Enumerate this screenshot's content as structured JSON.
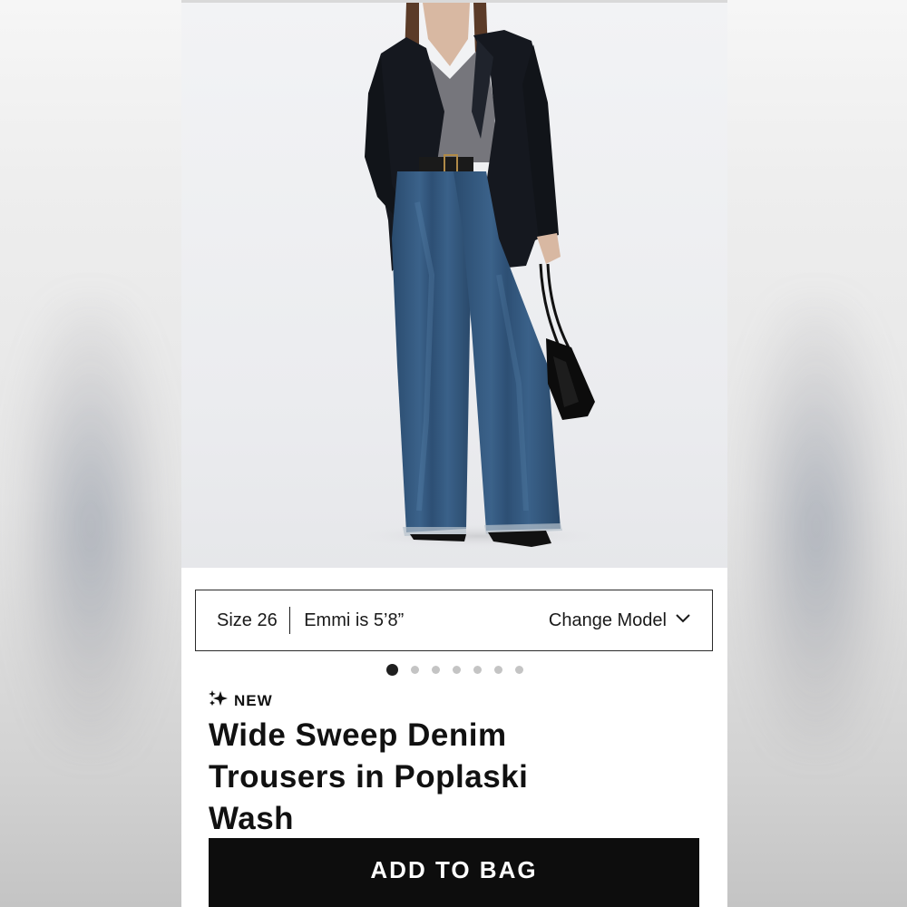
{
  "model_bar": {
    "size": "Size 26",
    "model_info": "Emmi is 5’8”",
    "change_model": "Change Model"
  },
  "carousel": {
    "total": 7,
    "active": 0
  },
  "product": {
    "badge": "NEW",
    "title": "Wide Sweep Denim Trousers in Poplaski Wash",
    "add_to_bag": "ADD TO BAG"
  },
  "colors": {
    "button_bg": "#0d0d0d",
    "denim": "#2f5478",
    "blazer": "#15181f",
    "sweater": "#77777d"
  },
  "icons": {
    "badge_icon": "sparkle-icon",
    "change_model_icon": "chevron-down-icon"
  }
}
